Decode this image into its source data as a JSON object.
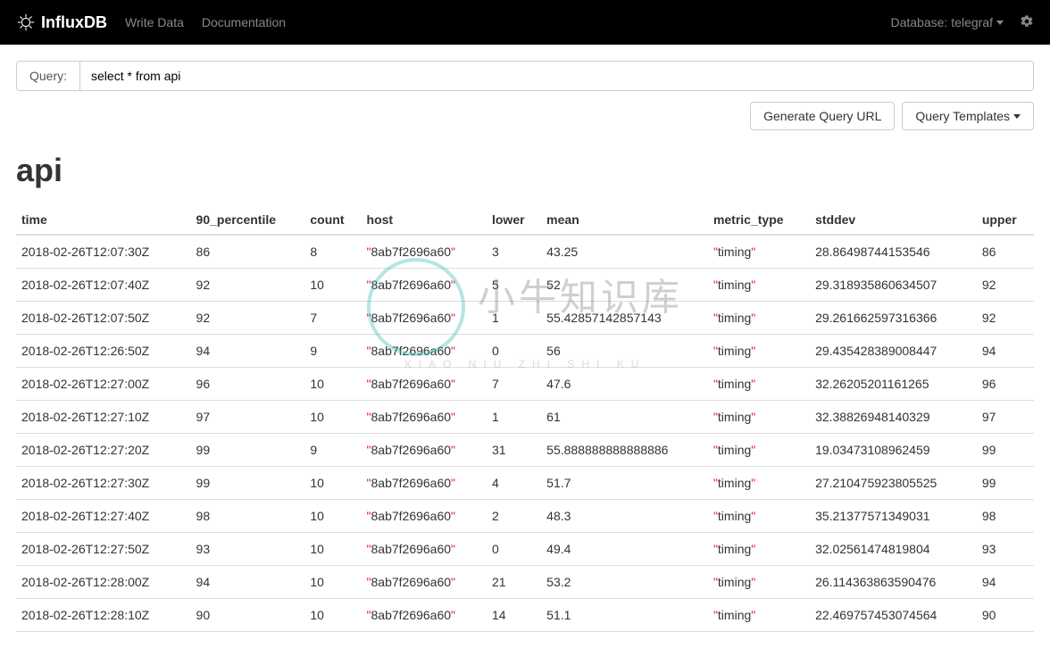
{
  "navbar": {
    "logo_text": "InfluxDB",
    "links": [
      {
        "label": "Write Data"
      },
      {
        "label": "Documentation"
      }
    ],
    "db_label_prefix": "Database: ",
    "db_name": "telegraf"
  },
  "query": {
    "label": "Query:",
    "value": "select * from api"
  },
  "buttons": {
    "generate_url": "Generate Query URL",
    "templates": "Query Templates"
  },
  "page_title": "api",
  "columns": [
    "time",
    "90_percentile",
    "count",
    "host",
    "lower",
    "mean",
    "metric_type",
    "stddev",
    "upper"
  ],
  "host_value": "8ab7f2696a60",
  "metric_type_value": "timing",
  "rows": [
    {
      "time": "2018-02-26T12:07:30Z",
      "p90": "86",
      "count": "8",
      "lower": "3",
      "mean": "43.25",
      "stddev": "28.86498744153546",
      "upper": "86"
    },
    {
      "time": "2018-02-26T12:07:40Z",
      "p90": "92",
      "count": "10",
      "lower": "5",
      "mean": "52",
      "stddev": "29.318935860634507",
      "upper": "92"
    },
    {
      "time": "2018-02-26T12:07:50Z",
      "p90": "92",
      "count": "7",
      "lower": "1",
      "mean": "55.42857142857143",
      "stddev": "29.261662597316366",
      "upper": "92"
    },
    {
      "time": "2018-02-26T12:26:50Z",
      "p90": "94",
      "count": "9",
      "lower": "0",
      "mean": "56",
      "stddev": "29.435428389008447",
      "upper": "94"
    },
    {
      "time": "2018-02-26T12:27:00Z",
      "p90": "96",
      "count": "10",
      "lower": "7",
      "mean": "47.6",
      "stddev": "32.26205201161265",
      "upper": "96"
    },
    {
      "time": "2018-02-26T12:27:10Z",
      "p90": "97",
      "count": "10",
      "lower": "1",
      "mean": "61",
      "stddev": "32.38826948140329",
      "upper": "97"
    },
    {
      "time": "2018-02-26T12:27:20Z",
      "p90": "99",
      "count": "9",
      "lower": "31",
      "mean": "55.888888888888886",
      "stddev": "19.03473108962459",
      "upper": "99"
    },
    {
      "time": "2018-02-26T12:27:30Z",
      "p90": "99",
      "count": "10",
      "lower": "4",
      "mean": "51.7",
      "stddev": "27.210475923805525",
      "upper": "99"
    },
    {
      "time": "2018-02-26T12:27:40Z",
      "p90": "98",
      "count": "10",
      "lower": "2",
      "mean": "48.3",
      "stddev": "35.21377571349031",
      "upper": "98"
    },
    {
      "time": "2018-02-26T12:27:50Z",
      "p90": "93",
      "count": "10",
      "lower": "0",
      "mean": "49.4",
      "stddev": "32.02561474819804",
      "upper": "93"
    },
    {
      "time": "2018-02-26T12:28:00Z",
      "p90": "94",
      "count": "10",
      "lower": "21",
      "mean": "53.2",
      "stddev": "26.114363863590476",
      "upper": "94"
    },
    {
      "time": "2018-02-26T12:28:10Z",
      "p90": "90",
      "count": "10",
      "lower": "14",
      "mean": "51.1",
      "stddev": "22.469757453074564",
      "upper": "90"
    }
  ],
  "watermark": {
    "main": "小牛知识库",
    "sub": "XIAO NIU ZHI SHI KU"
  }
}
